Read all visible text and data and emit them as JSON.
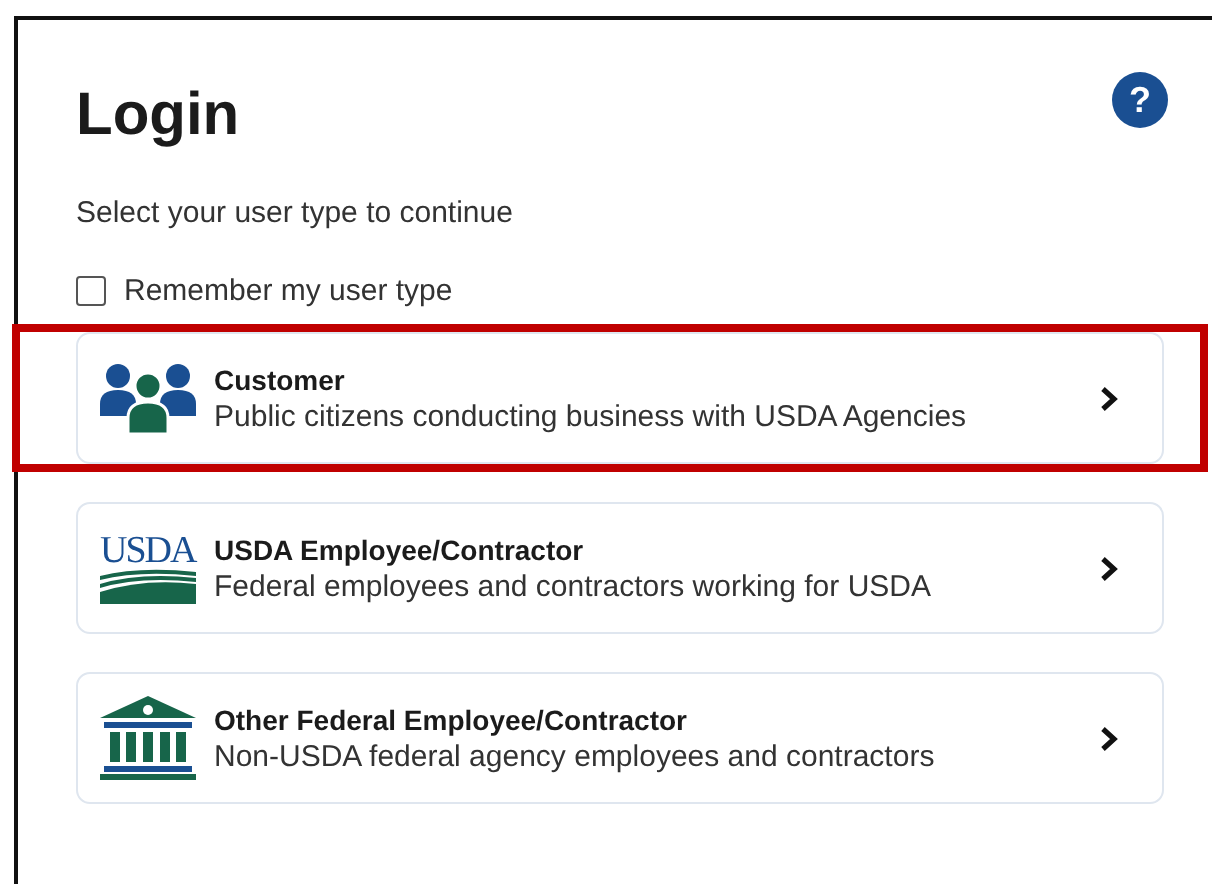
{
  "title": "Login",
  "help_button": {
    "label": "?"
  },
  "instruction": "Select your user type to continue",
  "remember": {
    "label": "Remember my user type",
    "checked": false
  },
  "options": [
    {
      "kind": "people",
      "title": "Customer",
      "description": "Public citizens conducting business with USDA Agencies",
      "highlighted": true
    },
    {
      "kind": "usda",
      "logo_text": "USDA",
      "title": "USDA Employee/Contractor",
      "description": "Federal employees and contractors working for USDA",
      "highlighted": false
    },
    {
      "kind": "building",
      "title": "Other Federal Employee/Contractor",
      "description": "Non-USDA federal agency employees and contractors",
      "highlighted": false
    }
  ]
}
